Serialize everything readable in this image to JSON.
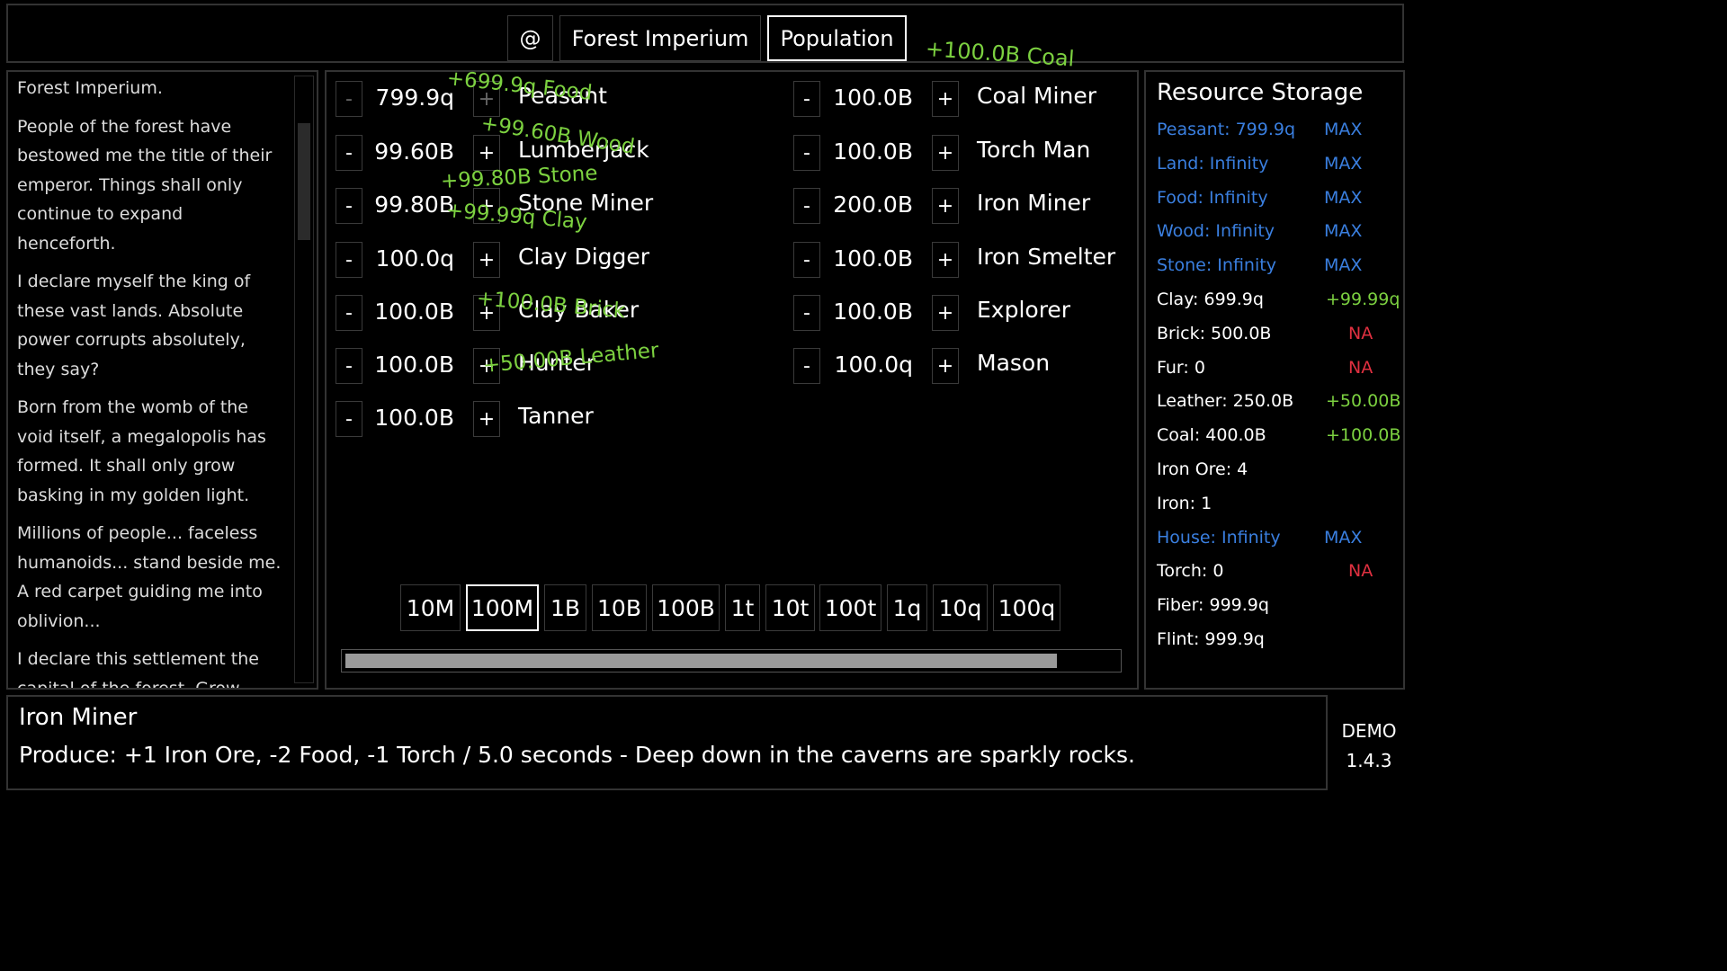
{
  "topbar": {
    "at_label": "@",
    "tab_empire": "Forest Imperium",
    "tab_population": "Population",
    "coal_float": "+100.0B Coal"
  },
  "story": {
    "paragraphs": [
      "Forest Imperium.",
      "People of the forest have bestowed me the title of their emperor. Things shall only continue to expand henceforth.",
      "I declare myself the king of these vast lands. Absolute power corrupts absolutely, they say?",
      "Born from the womb of the void itself, a megalopolis has formed. It shall only grow basking in my golden light.",
      "Millions of people... faceless humanoids... stand beside me. A red carpet guiding me into oblivion...",
      "I declare this settlement the capital of the forest. Grow beyond this pestilent place and carve our name into this world."
    ]
  },
  "population": {
    "minus": "-",
    "plus": "+",
    "left": [
      {
        "value": "799.9q",
        "name": "Peasant"
      },
      {
        "value": "99.60B",
        "name": "Lumberjack"
      },
      {
        "value": "99.80B",
        "name": "Stone Miner"
      },
      {
        "value": "100.0q",
        "name": "Clay Digger"
      },
      {
        "value": "100.0B",
        "name": "Clay Baker"
      },
      {
        "value": "100.0B",
        "name": "Hunter"
      },
      {
        "value": "100.0B",
        "name": "Tanner"
      }
    ],
    "right": [
      {
        "value": "100.0B",
        "name": "Coal Miner"
      },
      {
        "value": "100.0B",
        "name": "Torch Man"
      },
      {
        "value": "200.0B",
        "name": "Iron Miner"
      },
      {
        "value": "100.0B",
        "name": "Iron Smelter"
      },
      {
        "value": "100.0B",
        "name": "Explorer"
      },
      {
        "value": "100.0q",
        "name": "Mason"
      }
    ],
    "floats": [
      "+699.9q Food",
      "+99.60B Wood",
      "+99.80B Stone",
      "+99.99q Clay",
      "+100.0B Brick",
      "+50.00B Leather"
    ],
    "multipliers": [
      "10M",
      "100M",
      "1B",
      "10B",
      "100B",
      "1t",
      "10t",
      "100t",
      "1q",
      "10q",
      "100q"
    ],
    "selected_multiplier": "100M",
    "progress": 0.92
  },
  "storage": {
    "title": "Resource Storage",
    "rows": [
      {
        "label": "Peasant: 799.9q",
        "status": "MAX",
        "label_color": "#3a7fe0",
        "status_color": "#3a7fe0"
      },
      {
        "label": "Land: Infinity",
        "status": "MAX",
        "label_color": "#3a7fe0",
        "status_color": "#3a7fe0"
      },
      {
        "label": "Food: Infinity",
        "status": "MAX",
        "label_color": "#3a7fe0",
        "status_color": "#3a7fe0"
      },
      {
        "label": "Wood: Infinity",
        "status": "MAX",
        "label_color": "#3a7fe0",
        "status_color": "#3a7fe0"
      },
      {
        "label": "Stone: Infinity",
        "status": "MAX",
        "label_color": "#3a7fe0",
        "status_color": "#3a7fe0"
      },
      {
        "label": "Clay: 699.9q",
        "status": "+99.99q",
        "label_color": "#ffffff",
        "status_color": "#7cd140"
      },
      {
        "label": "Brick: 500.0B",
        "status": "NA",
        "label_color": "#ffffff",
        "status_color": "#e03040"
      },
      {
        "label": "Fur: 0",
        "status": "NA",
        "label_color": "#ffffff",
        "status_color": "#e03040"
      },
      {
        "label": "Leather: 250.0B",
        "status": "+50.00B",
        "label_color": "#ffffff",
        "status_color": "#7cd140"
      },
      {
        "label": "Coal: 400.0B",
        "status": "+100.0B",
        "label_color": "#ffffff",
        "status_color": "#7cd140"
      },
      {
        "label": "Iron Ore: 4",
        "status": "",
        "label_color": "#ffffff",
        "status_color": "#ffffff"
      },
      {
        "label": "Iron: 1",
        "status": "",
        "label_color": "#ffffff",
        "status_color": "#ffffff"
      },
      {
        "label": "House: Infinity",
        "status": "MAX",
        "label_color": "#3a7fe0",
        "status_color": "#3a7fe0"
      },
      {
        "label": "Torch: 0",
        "status": "NA",
        "label_color": "#ffffff",
        "status_color": "#e03040"
      },
      {
        "label": "Fiber: 999.9q",
        "status": "",
        "label_color": "#ffffff",
        "status_color": "#ffffff"
      },
      {
        "label": "Flint: 999.9q",
        "status": "",
        "label_color": "#ffffff",
        "status_color": "#ffffff"
      }
    ]
  },
  "info": {
    "title": "Iron Miner",
    "description": "Produce: +1 Iron Ore, -2 Food, -1 Torch / 5.0 seconds - Deep down in the caverns are sparkly rocks."
  },
  "version": {
    "label": "DEMO",
    "number": "1.4.3"
  },
  "colors": {
    "float_green": "#7cd140",
    "max_blue": "#3a7fe0",
    "na_red": "#e03040"
  }
}
